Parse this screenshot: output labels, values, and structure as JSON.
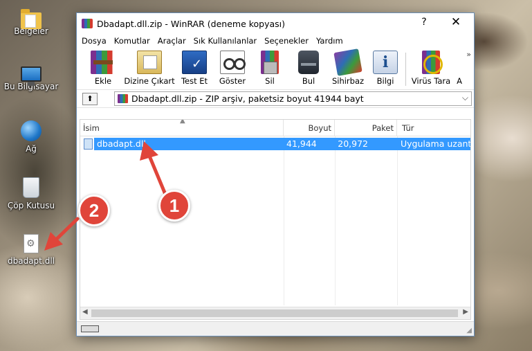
{
  "desktop": {
    "icons": [
      {
        "label": "Belgeler",
        "icon": "documents-folder-icon"
      },
      {
        "label": "Bu Bilgisayar",
        "icon": "computer-icon"
      },
      {
        "label": "Ağ",
        "icon": "network-icon"
      },
      {
        "label": "Çöp Kutusu",
        "icon": "recycle-bin-icon"
      },
      {
        "label": "dbadapt.dll",
        "icon": "dll-file-icon"
      }
    ]
  },
  "window": {
    "title": "Dbadapt.dll.zip - WinRAR (deneme kopyası)",
    "help_glyph": "?",
    "close_glyph": "✕",
    "menu": [
      "Dosya",
      "Komutlar",
      "Araçlar",
      "Sık Kullanılanlar",
      "Seçenekler",
      "Yardım"
    ],
    "toolbar": [
      {
        "label": "Ekle",
        "icon": "add-archive-icon"
      },
      {
        "label": "Dizine Çıkart",
        "icon": "extract-to-icon"
      },
      {
        "label": "Test Et",
        "icon": "test-icon"
      },
      {
        "label": "Göster",
        "icon": "view-icon"
      },
      {
        "label": "Sil",
        "icon": "delete-icon"
      },
      {
        "label": "Bul",
        "icon": "find-icon"
      },
      {
        "label": "Sihirbaz",
        "icon": "wizard-icon"
      },
      {
        "label": "Bilgi",
        "icon": "info-icon"
      },
      {
        "label": "Virüs Tara",
        "icon": "virus-scan-icon"
      },
      {
        "label": "A",
        "icon": ""
      }
    ],
    "toolbar_more": "»",
    "address": {
      "up_glyph": "⬆",
      "path": "Dbadapt.dll.zip - ZIP arşiv, paketsiz boyut 41944 bayt",
      "dropdown_glyph": "⌵"
    },
    "columns": [
      "İsim",
      "Boyut",
      "Paket",
      "Tür"
    ],
    "files": [
      {
        "name": "dbadapt.dll",
        "size": "41,944",
        "packed": "20,972",
        "type": "Uygulama uzantısı"
      }
    ],
    "scroll_left": "◀",
    "scroll_right": "▶"
  },
  "annotations": [
    "1",
    "2"
  ],
  "colors": {
    "selection": "#3399ff",
    "badge": "#e0453a"
  }
}
